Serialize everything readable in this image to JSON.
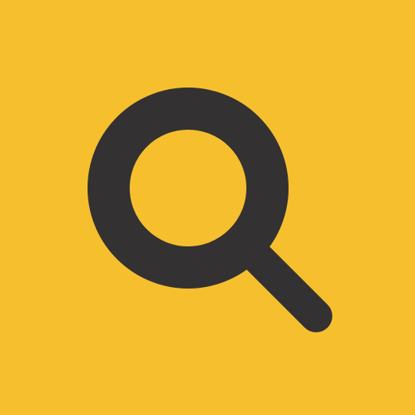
{
  "icon": {
    "name": "search-icon",
    "background_color": "#F6BF2E",
    "glyph_color": "#333132"
  }
}
